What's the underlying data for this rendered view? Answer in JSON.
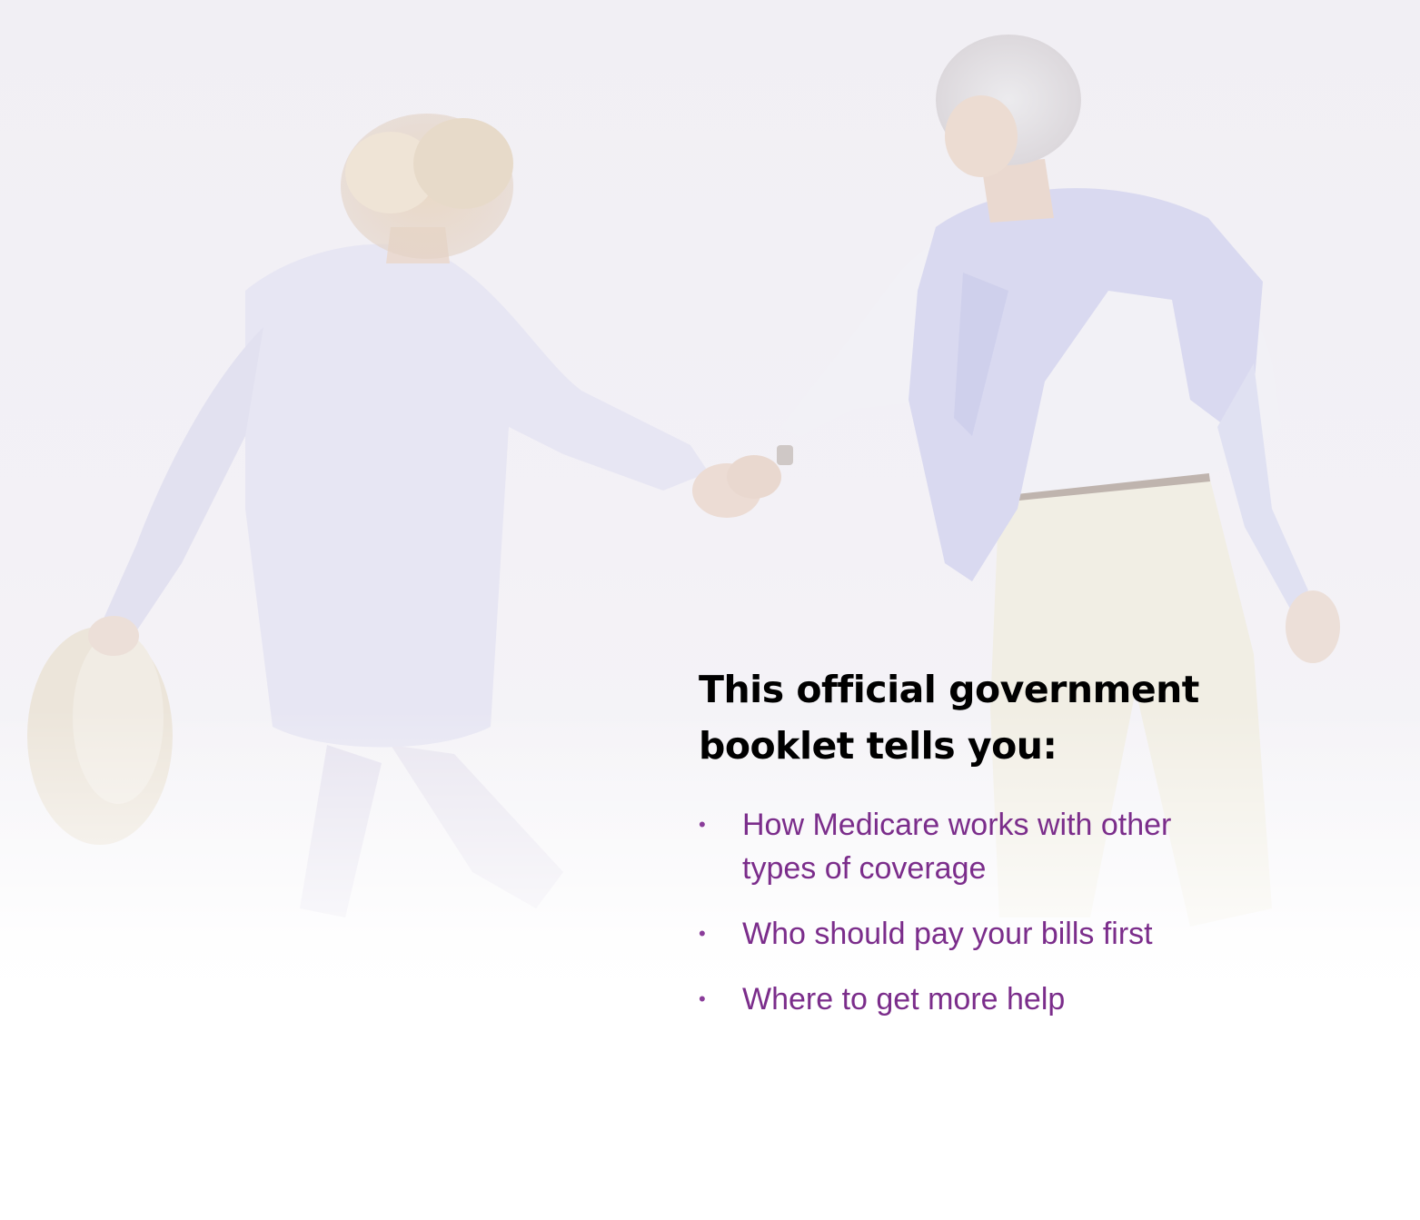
{
  "document": {
    "heading_lines": [
      "This official government",
      "booklet tells you:"
    ],
    "bullets": [
      {
        "lines": [
          "How Medicare works with other",
          "types of coverage"
        ]
      },
      {
        "lines": [
          "Who should pay your bills first"
        ]
      },
      {
        "lines": [
          "Where to get more help"
        ]
      }
    ],
    "bullet_glyph": "•",
    "colors": {
      "heading": "#000000",
      "bullet_text": "#7b2d8b",
      "background": "#ffffff"
    },
    "photo": {
      "description_icon": "couple-walking-hand-in-hand-photo"
    }
  }
}
